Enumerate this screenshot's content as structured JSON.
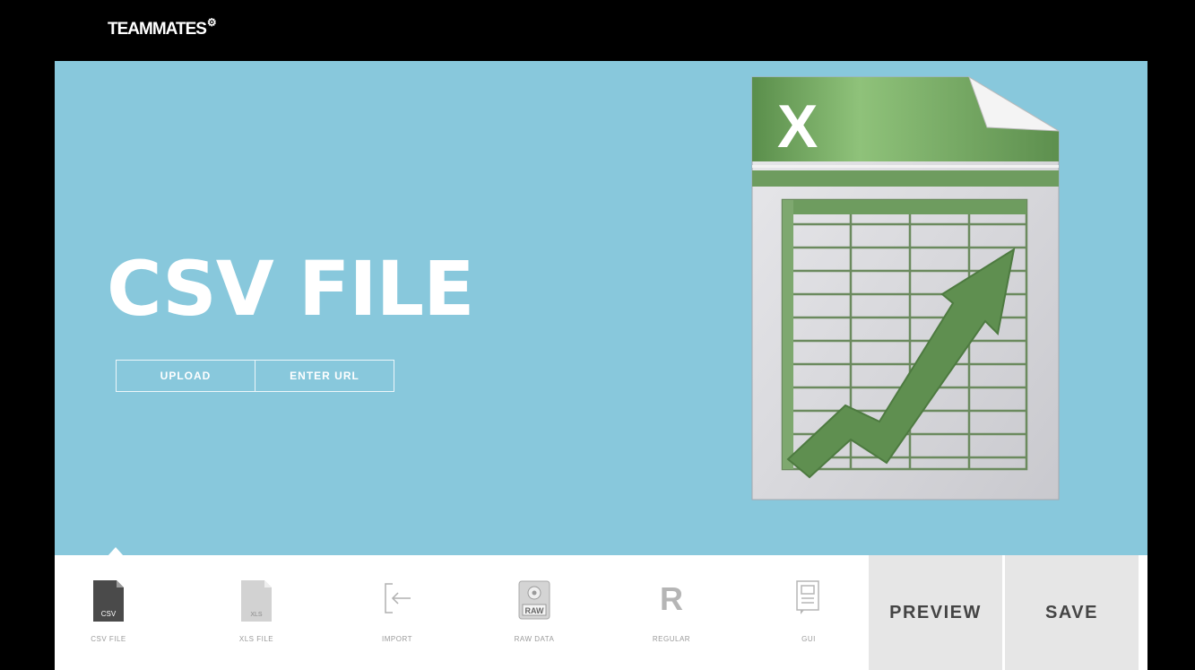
{
  "header": {
    "logo_text": "TEAMMATES",
    "logo_mark": "⚙"
  },
  "hero": {
    "title": "CSV FILE",
    "buttons": [
      {
        "label": "UPLOAD"
      },
      {
        "label": "ENTER URL"
      }
    ],
    "illustration": {
      "icon": "spreadsheet-trend-icon",
      "letter": "X"
    },
    "background_color": "#88c8dc"
  },
  "toolbar": {
    "items": [
      {
        "label": "CSV FILE",
        "icon": "csv-file-icon",
        "badge": "CSV"
      },
      {
        "label": "XLS FILE",
        "icon": "xls-file-icon",
        "badge": "XLS"
      },
      {
        "label": "IMPORT",
        "icon": "import-icon"
      },
      {
        "label": "RAW DATA",
        "icon": "raw-data-icon",
        "badge": "RAW"
      },
      {
        "label": "REGULAR",
        "icon": "regular-icon",
        "glyph": "R"
      },
      {
        "label": "GUI",
        "icon": "gui-icon"
      }
    ],
    "preview_label": "PREVIEW",
    "save_label": "SAVE"
  },
  "colors": {
    "excel_green": "#5d8f4e",
    "action_bg": "#e6e6e6"
  }
}
